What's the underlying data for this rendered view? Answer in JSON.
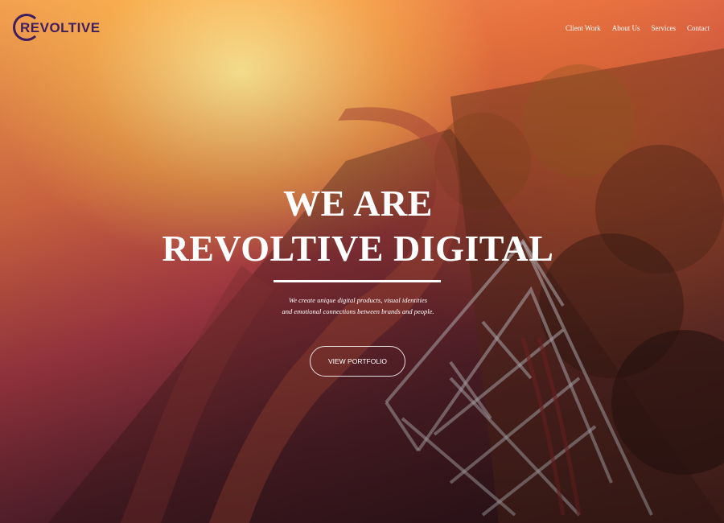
{
  "logo": {
    "text": "REVOLTIVE"
  },
  "nav": {
    "items": [
      {
        "label": "Client Work"
      },
      {
        "label": "About Us"
      },
      {
        "label": "Services"
      },
      {
        "label": "Contact"
      }
    ]
  },
  "hero": {
    "headline_line1": "WE ARE",
    "headline_line2": "REVOLTIVE DIGITAL",
    "tagline_line1": "We create unique digital products, visual identities",
    "tagline_line2": "and emotional connections between brands and people.",
    "cta_label": "VIEW PORTFOLIO"
  },
  "colors": {
    "logo": "#3f1d5e",
    "text": "#ffffff"
  }
}
